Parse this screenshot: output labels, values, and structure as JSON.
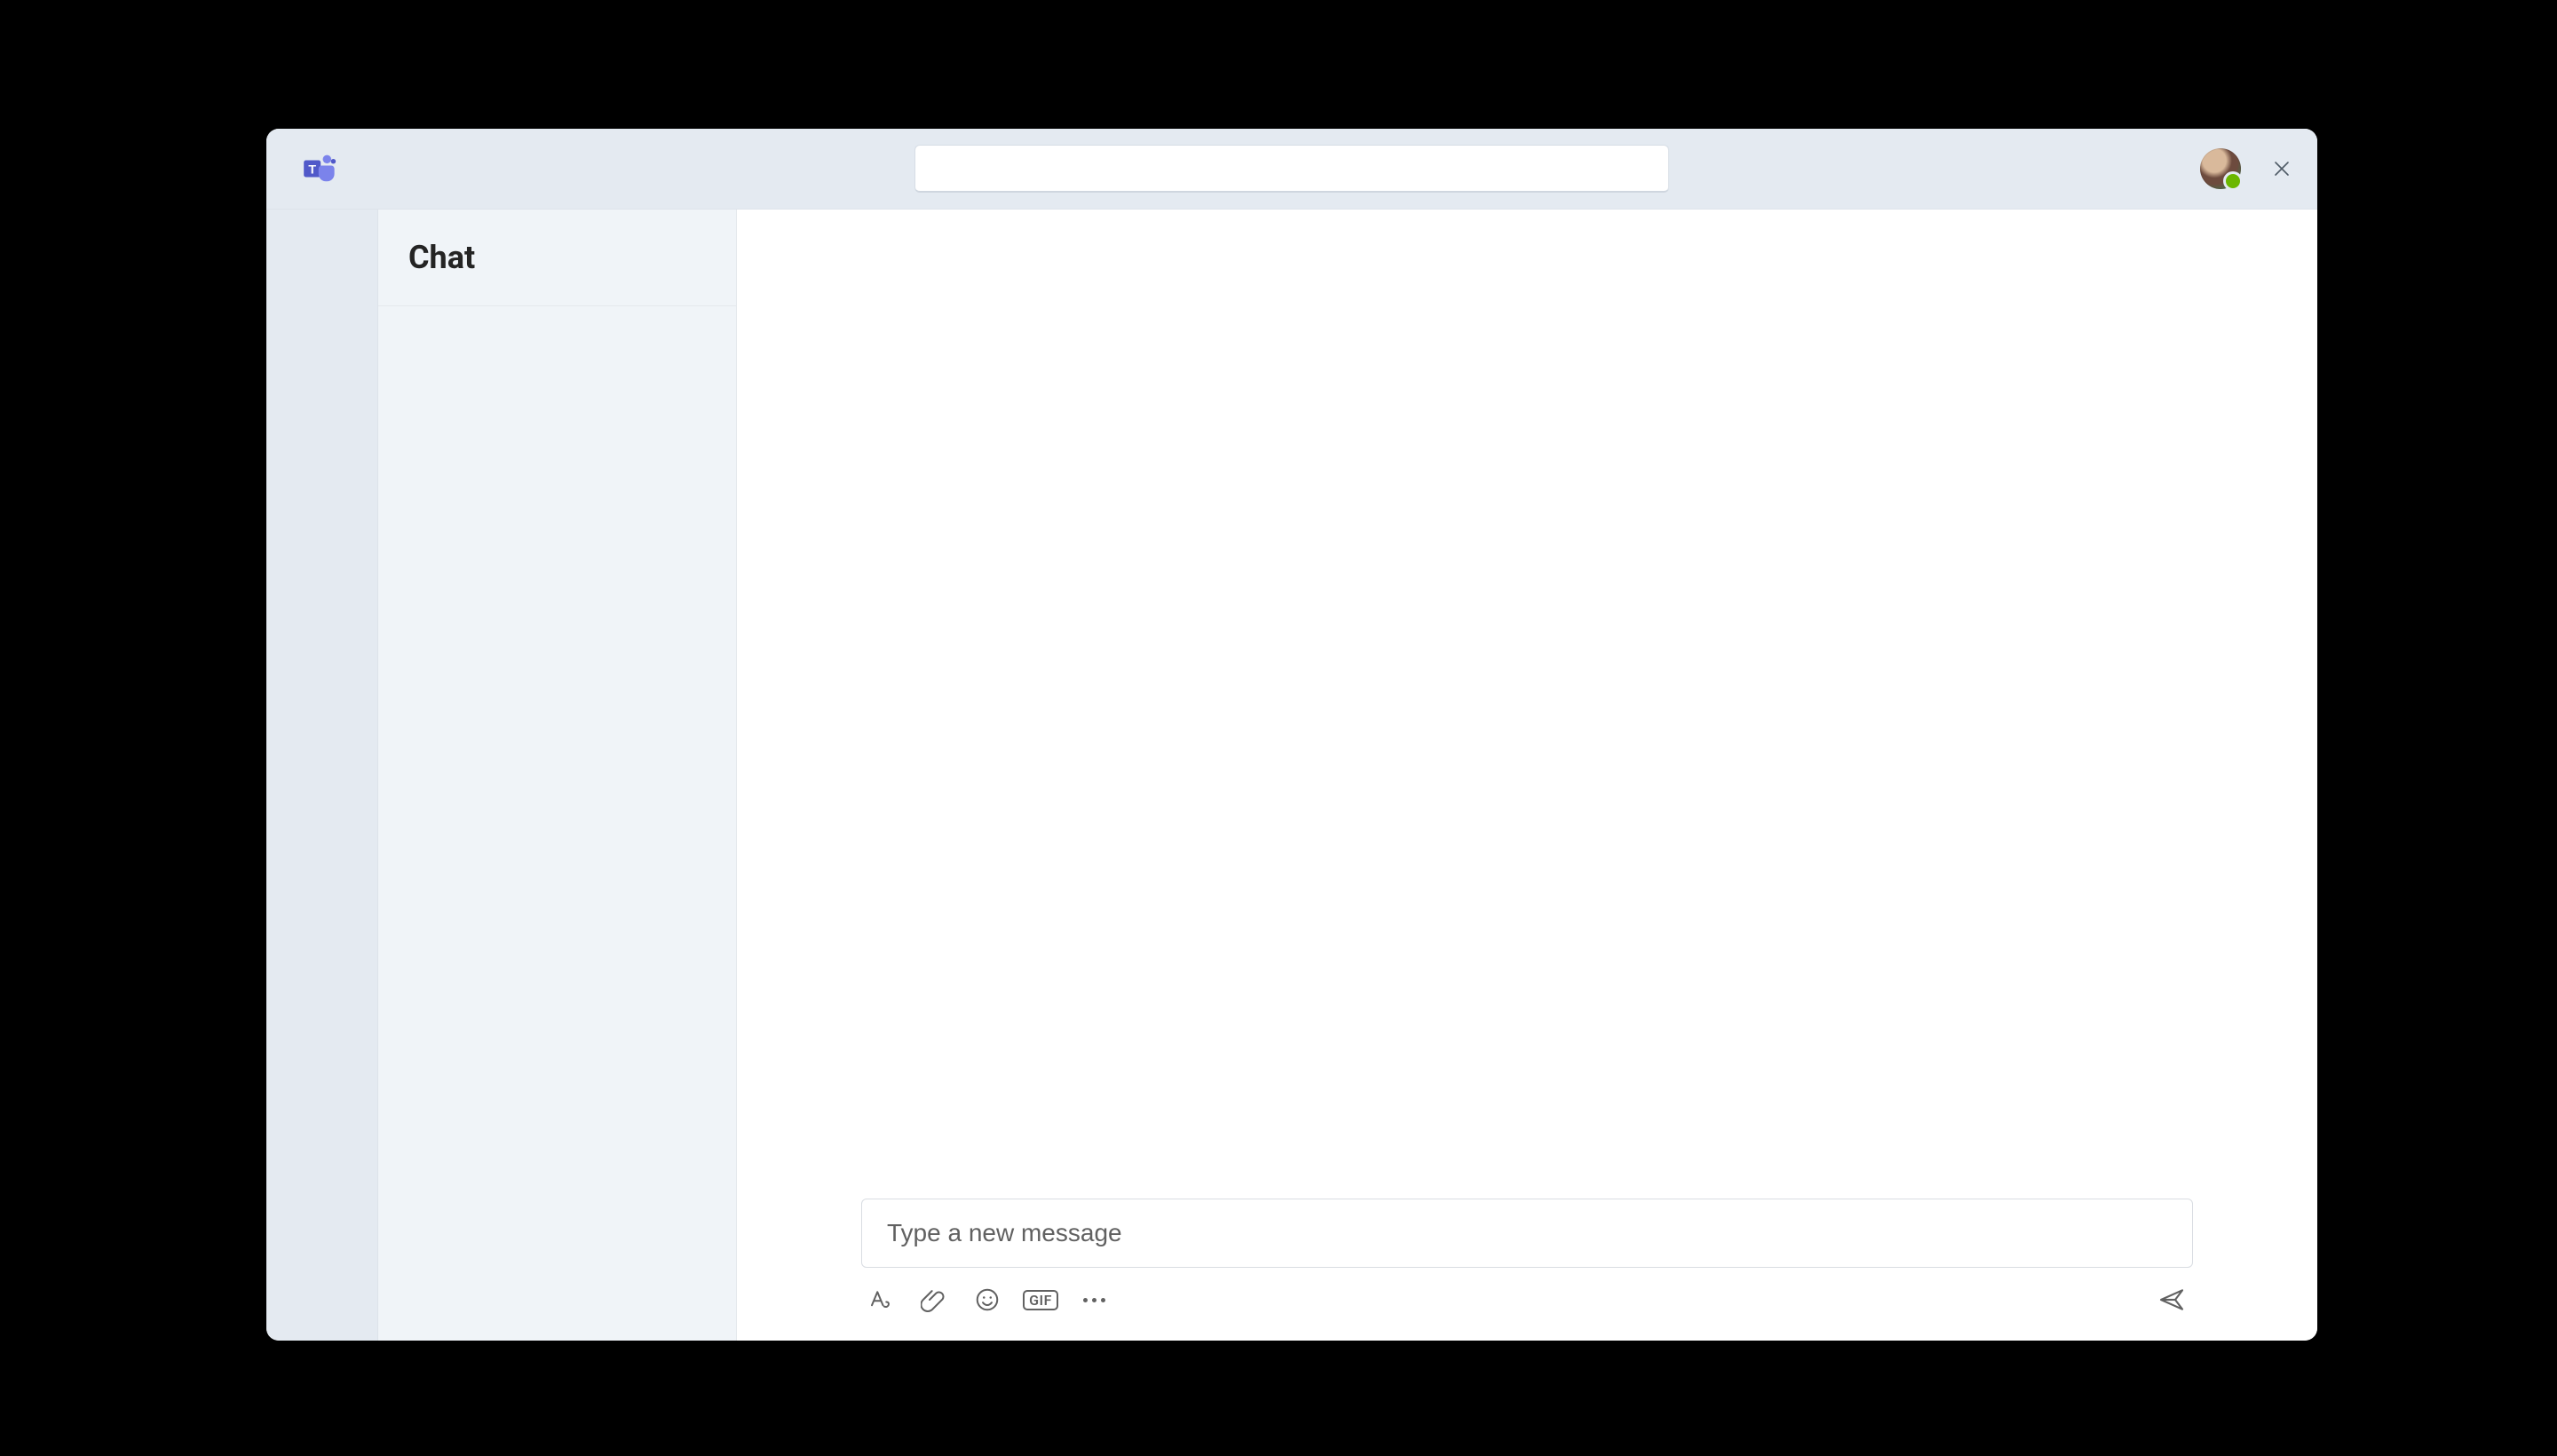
{
  "titlebar": {
    "search_value": "",
    "search_placeholder": ""
  },
  "conversation_panel": {
    "title": "Chat"
  },
  "composer": {
    "placeholder": "Type a new message",
    "value": "",
    "gif_label": "GIF"
  },
  "icons": {
    "teams": "teams-logo-icon",
    "close": "close-icon",
    "format": "format-text-icon",
    "attach": "attachment-icon",
    "emoji": "emoji-icon",
    "gif": "gif-icon",
    "more": "more-options-icon",
    "send": "send-icon"
  },
  "presence": {
    "status": "available",
    "color": "#6bb700"
  }
}
